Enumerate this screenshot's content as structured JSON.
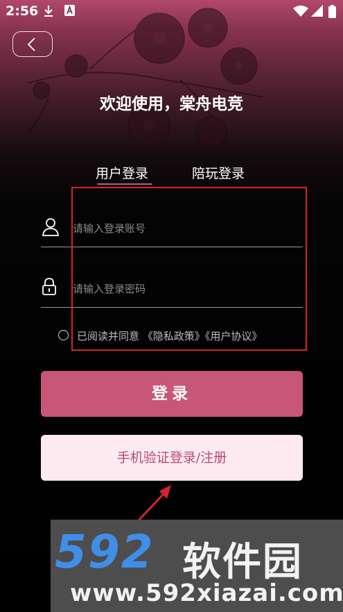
{
  "status_bar": {
    "time": "2:56",
    "icons": [
      "download-icon",
      "a-badge-icon",
      "wifi-icon",
      "cellular-icon",
      "battery-icon"
    ]
  },
  "header": {
    "back_icon": "chevron-left-icon",
    "welcome": "欢迎使用，棠舟电竞"
  },
  "tabs": [
    {
      "label": "用户登录",
      "active": true
    },
    {
      "label": "陪玩登录",
      "active": false
    }
  ],
  "form": {
    "account_placeholder": "请输入登录账号",
    "account_value": "",
    "password_placeholder": "请输入登录密码",
    "password_value": "",
    "agreement_prefix": "已阅读并同意",
    "privacy_policy": "《隐私政策》",
    "user_agreement": "《用户协议》",
    "agreement_checked": false
  },
  "buttons": {
    "login": "登录",
    "phone_login": "手机验证登录/注册"
  },
  "watermark": {
    "number": "592",
    "name": "软件园",
    "url": "www.592xiazai.com"
  },
  "colors": {
    "accent": "#c85679",
    "phone_button_bg": "#fdeaf1",
    "phone_button_text": "#b84b6e",
    "annotation_red": "#d8232a",
    "watermark_blue": "#3f8ee8"
  }
}
